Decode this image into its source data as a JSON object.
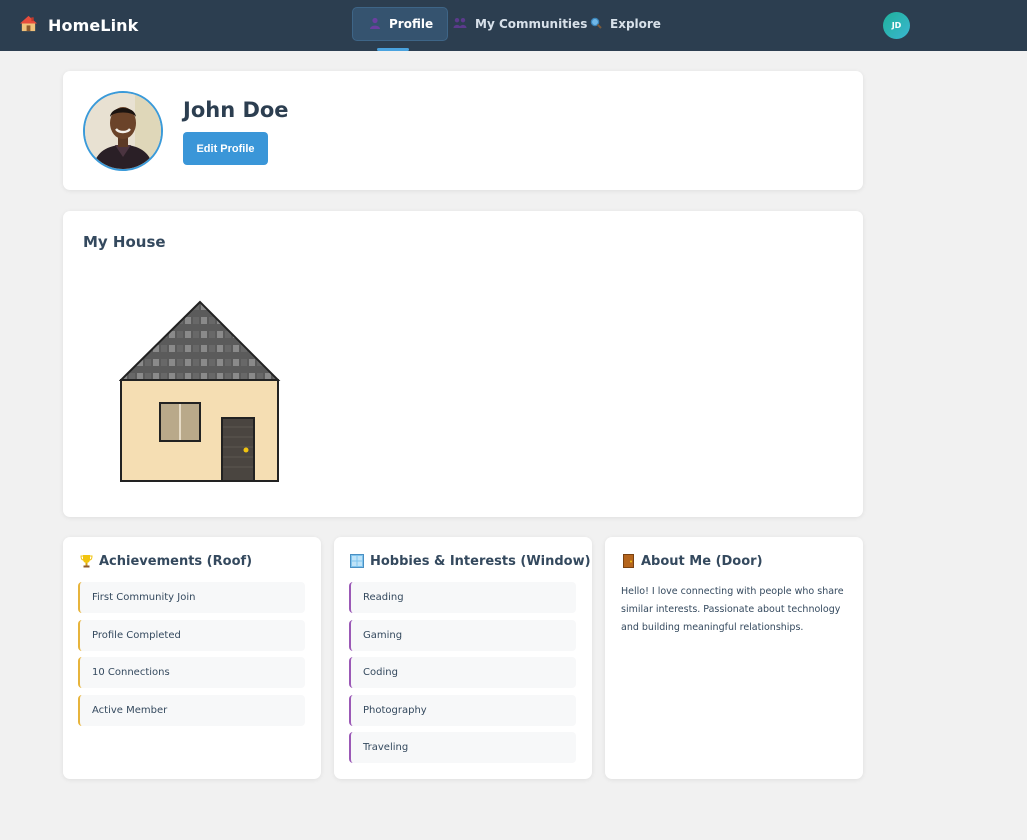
{
  "app": {
    "name": "HomeLink",
    "logo_icon": "house-icon"
  },
  "nav": {
    "items": [
      {
        "label": "Profile",
        "icon": "person-icon",
        "active": true
      },
      {
        "label": "My Communities",
        "icon": "people-icon",
        "active": false
      },
      {
        "label": "Explore",
        "icon": "magnifier-icon",
        "active": false
      }
    ],
    "user_initials": "JD"
  },
  "profile": {
    "name": "John Doe",
    "edit_label": "Edit Profile"
  },
  "house": {
    "title": "My House",
    "colors": {
      "roof": "#5b5b5b",
      "roof_pattern": "#888888",
      "wall": "#f5deb3",
      "window": "#b9a98a",
      "door": "#4a4540",
      "knob": "#f1c40f"
    }
  },
  "achievements": {
    "title": "Achievements (Roof)",
    "icon": "trophy-icon",
    "items": [
      "First Community Join",
      "Profile Completed",
      "10 Connections",
      "Active Member"
    ]
  },
  "hobbies": {
    "title": "Hobbies & Interests (Window)",
    "icon": "window-icon",
    "items": [
      "Reading",
      "Gaming",
      "Coding",
      "Photography",
      "Traveling"
    ]
  },
  "about": {
    "title": "About Me (Door)",
    "icon": "door-icon",
    "text": "Hello! I love connecting with people who share similar interests. Passionate about technology and building meaningful relationships."
  },
  "colors": {
    "header_bg": "#2c3e50",
    "accent": "#3a96d8",
    "achievement_accent": "#e7b43c",
    "hobby_accent": "#9b59b6"
  }
}
